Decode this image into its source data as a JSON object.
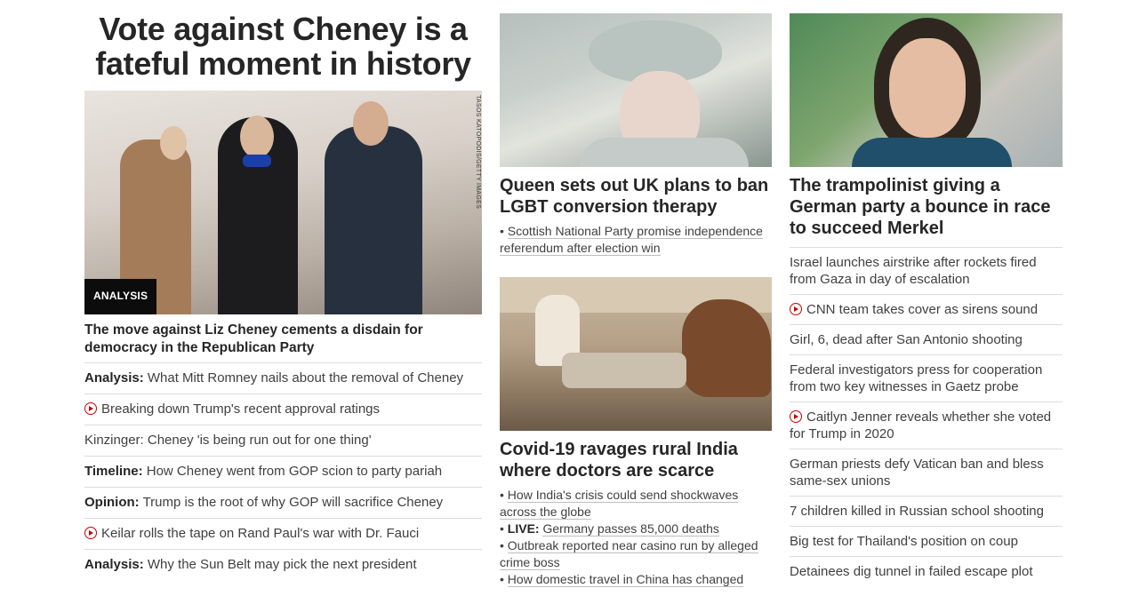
{
  "col1": {
    "headline": "Vote against Cheney is a fateful moment in history",
    "image": {
      "badge": "ANALYSIS",
      "credit": "TASOS KATOPODIS/GETTY IMAGES"
    },
    "story_headline": "The move against Liz Cheney cements a disdain for democracy in the Republican Party",
    "items": [
      {
        "label": "Analysis:",
        "text": "What Mitt Romney nails about the removal of Cheney",
        "icon": ""
      },
      {
        "label": "",
        "text": "Breaking down Trump's recent approval ratings",
        "icon": "play-icon"
      },
      {
        "label": "",
        "text": "Kinzinger: Cheney 'is being run out for one thing'",
        "icon": ""
      },
      {
        "label": "Timeline:",
        "text": "How Cheney went from GOP scion to party pariah",
        "icon": ""
      },
      {
        "label": "Opinion:",
        "text": "Trump is the root of why GOP will sacrifice Cheney",
        "icon": ""
      },
      {
        "label": "",
        "text": "Keilar rolls the tape on Rand Paul's war with Dr. Fauci",
        "icon": "play-icon"
      },
      {
        "label": "Analysis:",
        "text": "Why the Sun Belt may pick the next president",
        "icon": ""
      }
    ]
  },
  "col2": {
    "story1": {
      "headline": "Queen sets out UK plans to ban LGBT conversion therapy",
      "bullets": [
        {
          "live": "",
          "text": "Scottish National Party promise independence referendum after election win"
        }
      ]
    },
    "story2": {
      "headline": "Covid-19 ravages rural India where doctors are scarce",
      "bullets": [
        {
          "live": "",
          "text": "How India's crisis could send shockwaves across the globe"
        },
        {
          "live": "LIVE:",
          "text": "Germany passes 85,000 deaths"
        },
        {
          "live": "",
          "text": "Outbreak reported near casino run by alleged crime boss"
        },
        {
          "live": "",
          "text": "How domestic travel in China has changed"
        }
      ]
    }
  },
  "col3": {
    "headline": "The trampolinist giving a German party a bounce in race to succeed Merkel",
    "items": [
      {
        "text": "Israel launches airstrike after rockets fired from Gaza in day of escalation",
        "icon": ""
      },
      {
        "text": "CNN team takes cover as sirens sound",
        "icon": "play-icon"
      },
      {
        "text": "Girl, 6, dead after San Antonio shooting",
        "icon": ""
      },
      {
        "text": "Federal investigators press for cooperation from two key witnesses in Gaetz probe",
        "icon": ""
      },
      {
        "text": "Caitlyn Jenner reveals whether she voted for Trump in 2020",
        "icon": "play-icon"
      },
      {
        "text": "German priests defy Vatican ban and bless same-sex unions",
        "icon": ""
      },
      {
        "text": "7 children killed in Russian school shooting",
        "icon": ""
      },
      {
        "text": "Big test for Thailand's position on coup",
        "icon": ""
      },
      {
        "text": "Detainees dig tunnel in failed escape plot",
        "icon": ""
      }
    ]
  },
  "colors": {
    "accent": "#cc0000",
    "text": "#262626",
    "divider": "#dcdcdc",
    "badge_bg": "#0c0c0c"
  }
}
